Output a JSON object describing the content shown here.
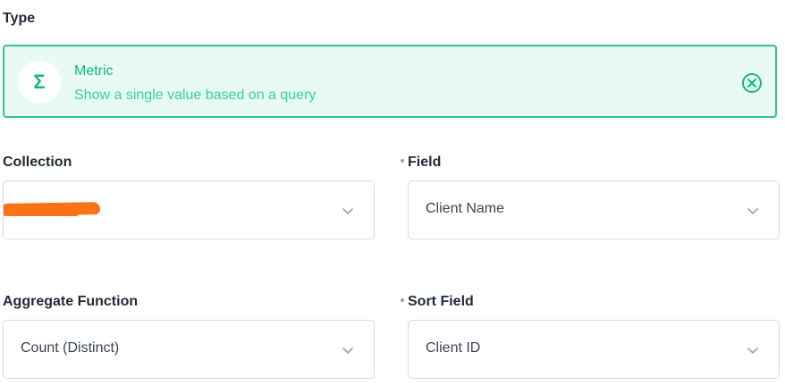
{
  "type_section": {
    "label": "Type",
    "selected": {
      "icon": "sigma-icon",
      "icon_glyph": "Σ",
      "title": "Metric",
      "description": "Show a single value based on a query"
    }
  },
  "fields": {
    "collection": {
      "label": "Collection",
      "value": "",
      "redacted": true
    },
    "field": {
      "label": "Field",
      "value": "Client Name",
      "required_dot": true
    },
    "aggregate_function": {
      "label": "Aggregate Function",
      "value": "Count (Distinct)"
    },
    "sort_field": {
      "label": "Sort Field",
      "value": "Client ID",
      "required_dot": true
    }
  },
  "colors": {
    "accent": "#10b981",
    "accent_light": "#e8faf3",
    "border": "#d6dbe1",
    "redaction": "#f97316"
  }
}
